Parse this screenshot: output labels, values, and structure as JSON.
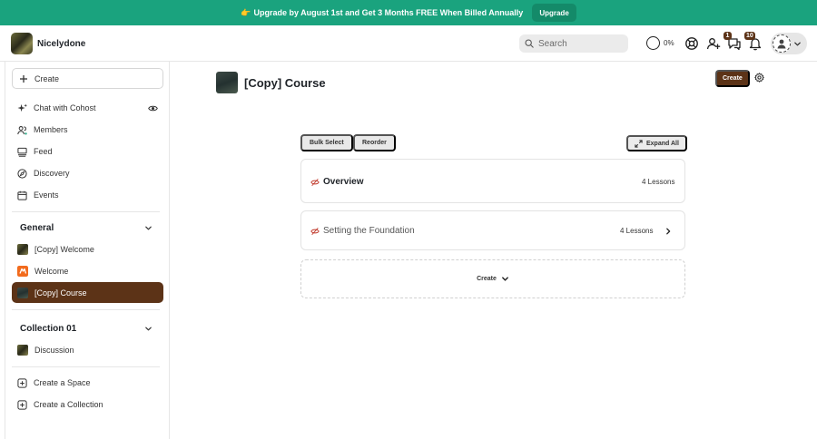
{
  "banner": {
    "emoji": "👉",
    "text": "Upgrade by August 1st and Get 3 Months FREE When Billed Annually",
    "button_label": "Upgrade"
  },
  "topbar": {
    "brand_name": "Nicelydone",
    "search_placeholder": "Search",
    "progress_percent": "0%",
    "notifications": {
      "chat_count": "1",
      "inbox_count": "10"
    }
  },
  "sidebar": {
    "create_label": "Create",
    "nav": [
      {
        "label": "Chat with Cohost",
        "icon": "sparkle-icon"
      },
      {
        "label": "Members",
        "icon": "users-icon"
      },
      {
        "label": "Feed",
        "icon": "feed-icon"
      },
      {
        "label": "Discovery",
        "icon": "compass-icon"
      },
      {
        "label": "Events",
        "icon": "calendar-icon"
      }
    ],
    "sections": [
      {
        "title": "General",
        "items": [
          {
            "label": "[Copy] Welcome"
          },
          {
            "label": "Welcome"
          },
          {
            "label": "[Copy] Course",
            "active": true
          }
        ]
      },
      {
        "title": "Collection 01",
        "items": [
          {
            "label": "Discussion"
          }
        ]
      }
    ],
    "footer": [
      {
        "label": "Create a Space"
      },
      {
        "label": "Create a Collection"
      }
    ]
  },
  "main": {
    "title": "[Copy] Course",
    "create_label": "Create",
    "bulk_select_label": "Bulk Select",
    "reorder_label": "Reorder",
    "expand_all_label": "Expand All",
    "sections": [
      {
        "title": "Overview",
        "lessons": "4 Lessons"
      },
      {
        "title": "Setting the Foundation",
        "lessons": "4 Lessons"
      }
    ],
    "add_section_label": "Create"
  },
  "colors": {
    "banner_bg": "#1aa37e",
    "accent_brown": "#5c3317"
  }
}
